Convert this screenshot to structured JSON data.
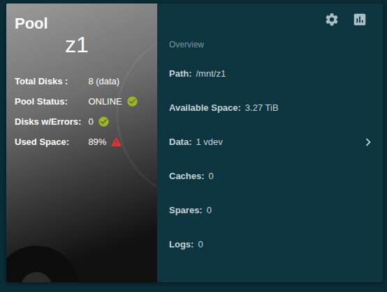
{
  "card": {
    "title": "Pool",
    "pool_name": "z1"
  },
  "stats": [
    {
      "label": "Total Disks :",
      "value": "8 (data)",
      "kind": "plain"
    },
    {
      "label": "Pool Status:",
      "value": "ONLINE",
      "kind": "ok"
    },
    {
      "label": "Disks w/Errors:",
      "value": "0",
      "kind": "ok"
    },
    {
      "label": "Used Space:",
      "value": "89%",
      "kind": "warning"
    }
  ],
  "overview": {
    "heading": "Overview",
    "rows": [
      {
        "label": "Path:",
        "value": "/mnt/z1",
        "expandable": false
      },
      {
        "label": "Available Space:",
        "value": "3.27 TiB",
        "expandable": false
      },
      {
        "label": "Data:",
        "value": "1 vdev",
        "expandable": true
      },
      {
        "label": "Caches:",
        "value": "0",
        "expandable": false
      },
      {
        "label": "Spares:",
        "value": "0",
        "expandable": false
      },
      {
        "label": "Logs:",
        "value": "0",
        "expandable": false
      }
    ]
  }
}
